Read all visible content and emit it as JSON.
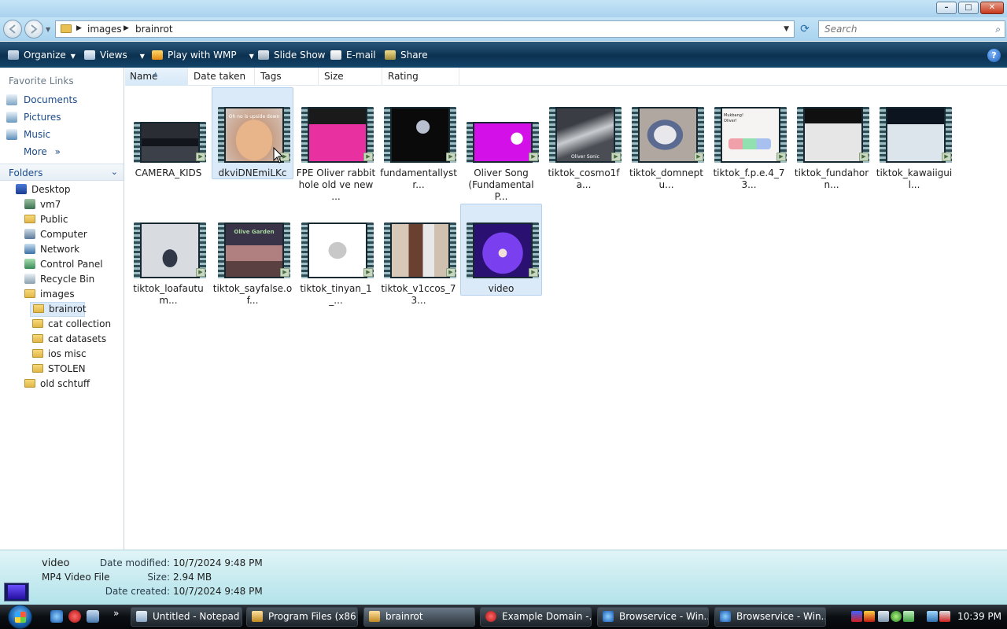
{
  "window": {
    "minimize": "–",
    "maximize": "□",
    "close": "✕"
  },
  "address": {
    "crumbs": [
      "images",
      "brainrot"
    ],
    "search_placeholder": "Search"
  },
  "toolbar": {
    "organize": "Organize",
    "views": "Views",
    "play": "Play with WMP",
    "slideshow": "Slide Show",
    "email": "E-mail",
    "share": "Share",
    "help": "?"
  },
  "nav": {
    "favorites_header": "Favorite Links",
    "favorites": [
      "Documents",
      "Pictures",
      "Music"
    ],
    "more": "More",
    "more_glyph": "»",
    "folders_header": "Folders",
    "tree": [
      "Desktop",
      "vm7",
      "Public",
      "Computer",
      "Network",
      "Control Panel",
      "Recycle Bin",
      "images",
      "brainrot",
      "cat collection",
      "cat datasets",
      "ios misc",
      "STOLEN",
      "old schtuff"
    ]
  },
  "columns": [
    "Name",
    "Date taken",
    "Tags",
    "Size",
    "Rating"
  ],
  "files": [
    {
      "line1": "CAMERA_KIDS",
      "line2": ""
    },
    {
      "line1": "dkviDNEmiLKc",
      "line2": ""
    },
    {
      "line1": "FPE Oliver rabbit",
      "line2": "hole old ve new ..."
    },
    {
      "line1": "fundamentallystr...",
      "line2": ""
    },
    {
      "line1": "Oliver Song",
      "line2": "(Fundamental P..."
    },
    {
      "line1": "tiktok_cosmo1fa...",
      "line2": ""
    },
    {
      "line1": "tiktok_domneptu...",
      "line2": ""
    },
    {
      "line1": "tiktok_f.p.e.4_73...",
      "line2": ""
    },
    {
      "line1": "tiktok_fundahorn...",
      "line2": ""
    },
    {
      "line1": "tiktok_kawaiiguil...",
      "line2": ""
    },
    {
      "line1": "tiktok_loafautum...",
      "line2": ""
    },
    {
      "line1": "tiktok_sayfalse.of...",
      "line2": ""
    },
    {
      "line1": "tiktok_tinyan_1_...",
      "line2": ""
    },
    {
      "line1": "tiktok_v1ccos_73...",
      "line2": ""
    },
    {
      "line1": "video",
      "line2": ""
    }
  ],
  "thumb_text": {
    "dkvi": "Oh no is upside down",
    "mukbang": "Mukbang! Oliver!",
    "cosmo": "Oliver Sonic",
    "olive": "Olive Garden"
  },
  "details": {
    "name": "video",
    "type": "MP4 Video File",
    "modified_label": "Date modified:",
    "modified": "10/7/2024 9:48 PM",
    "size_label": "Size:",
    "size": "2.94 MB",
    "created_label": "Date created:",
    "created": "10/7/2024 9:48 PM"
  },
  "taskbar": {
    "tasks": [
      "Untitled - Notepad",
      "Program Files (x86)",
      "brainrot",
      "Example Domain -...",
      "Browservice - Win...",
      "Browservice - Win..."
    ],
    "clock": "10:39 PM",
    "more_glyph": "»"
  }
}
